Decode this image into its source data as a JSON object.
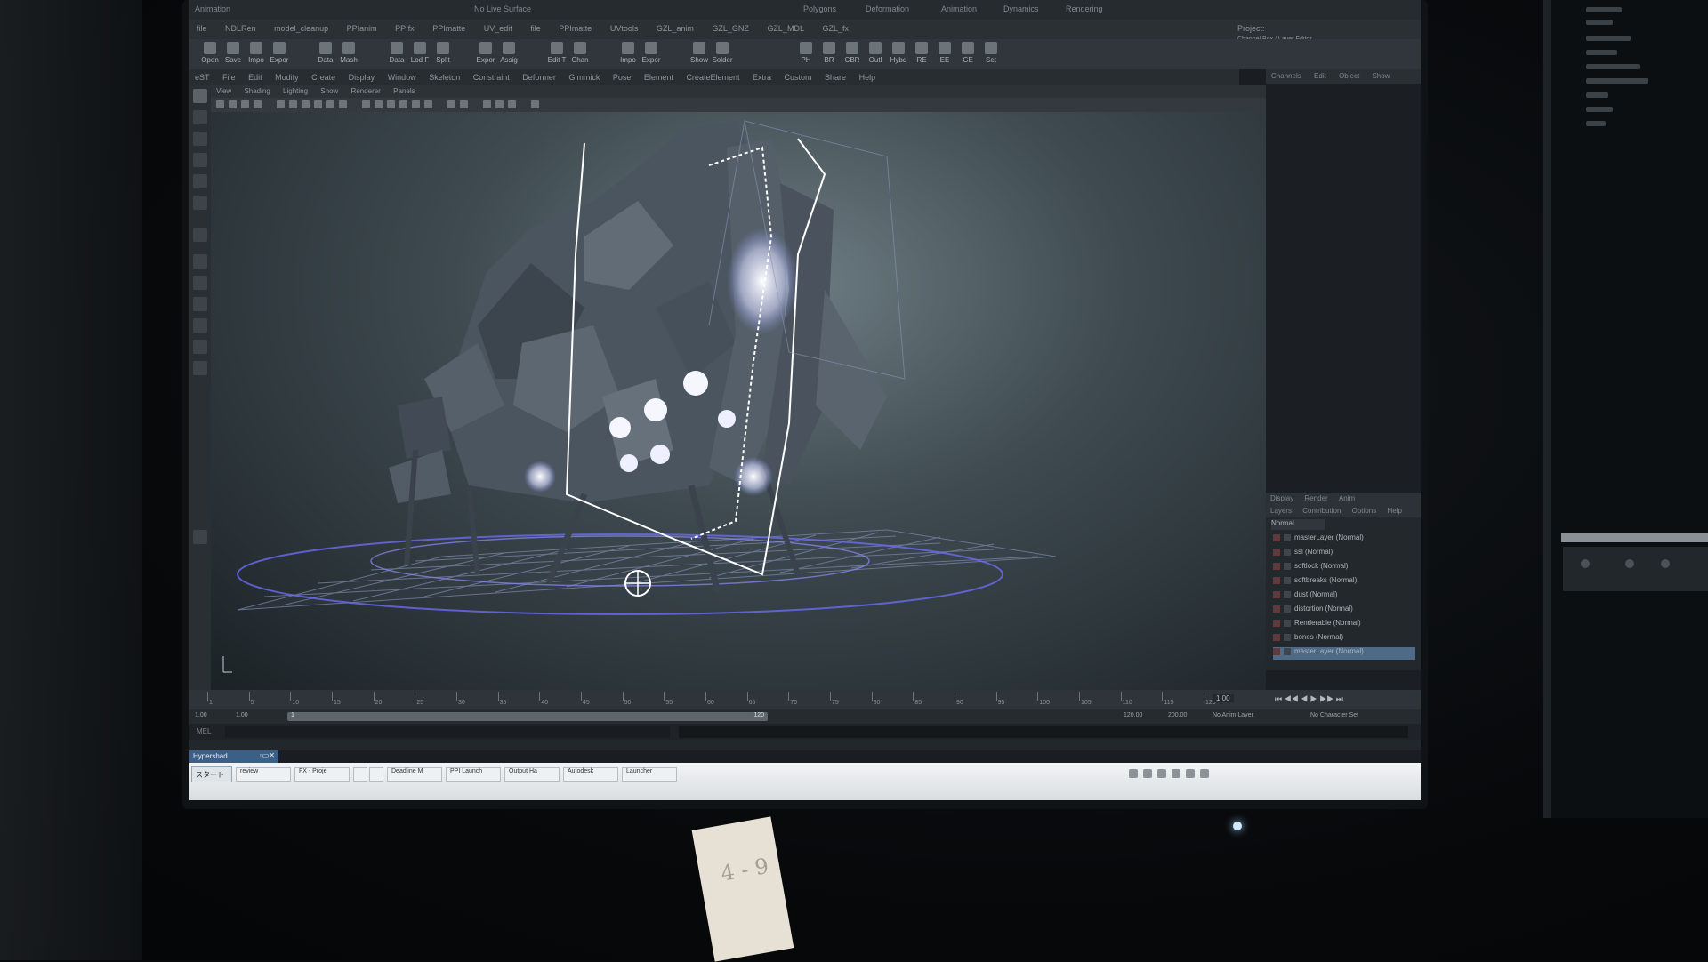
{
  "maya": {
    "mode": "Animation",
    "status_field": "No Live Surface",
    "top_menu": [
      "Polygons",
      "Deformation",
      "Animation",
      "Dynamics",
      "Rendering"
    ],
    "shelf_tabs": [
      "file",
      "NDLRen",
      "model_cleanup",
      "PPIanim",
      "PPIfx",
      "PPImatte",
      "UV_edit",
      "file",
      "PPImatte",
      "UVtools",
      "GZL_anim",
      "GZL_GNZ",
      "GZL_MDL",
      "GZL_fx"
    ],
    "shelf_buttons": [
      "Open",
      "Save",
      "Impo",
      "Expor",
      "Data",
      "Mash",
      "Data",
      "Lod F",
      "Split",
      "Expor",
      "Assig",
      "Edit T",
      "Chan",
      "Impo",
      "Expor",
      "Show",
      "Solder"
    ],
    "shelf_right_buttons": [
      "PH",
      "BR",
      "CBR",
      "Outl",
      "Hybd",
      "RE",
      "EE",
      "GE",
      "Set"
    ],
    "main_menu": [
      "eST",
      "File",
      "Edit",
      "Modify",
      "Create",
      "Display",
      "Window",
      "Skeleton",
      "Constraint",
      "Deformer",
      "Gimmick",
      "Pose",
      "Element",
      "CreateElement",
      "Extra",
      "Custom",
      "Share",
      "Help"
    ],
    "panel_menu": [
      "View",
      "Shading",
      "Lighting",
      "Show",
      "Renderer",
      "Panels"
    ],
    "channel_tabs": [
      "Channels",
      "Edit",
      "Object",
      "Show"
    ],
    "project_label": "Project:",
    "project_sub": "Channel Box / Layer Editor",
    "layer_tabs": [
      "Display",
      "Render",
      "Anim"
    ],
    "layer_subtabs": [
      "Layers",
      "Contribution",
      "Options",
      "Help"
    ],
    "layer_mode": "Normal",
    "layers": [
      "masterLayer (Normal)",
      "ssl (Normal)",
      "softlock (Normal)",
      "softbreaks (Normal)",
      "dust (Normal)",
      "distortion (Normal)",
      "Renderable (Normal)",
      "bones (Normal)",
      "masterLayer (Normal)"
    ],
    "timeline_ticks": [
      "1",
      "5",
      "10",
      "15",
      "20",
      "25",
      "30",
      "35",
      "40",
      "45",
      "50",
      "55",
      "60",
      "65",
      "70",
      "75",
      "80",
      "85",
      "90",
      "95",
      "100",
      "105",
      "110",
      "115",
      "120"
    ],
    "current_frame": "1.00",
    "range_start": "1.00",
    "range_inner_start": "1.00",
    "range_inner_value": "1",
    "range_inner_end": "120",
    "range_end": "120.00",
    "range_max": "200.00",
    "anim_layer": "No Anim Layer",
    "char_set": "No Character Set",
    "cmd_label": "MEL",
    "hypershade_tab": "Hypershad"
  },
  "taskbar": {
    "start_label": "スタート",
    "tasks": [
      "review",
      "FX - Proje",
      "",
      "",
      "Deadline M",
      "PPI Launch",
      "Output Ha",
      "Autodesk",
      "Launcher"
    ]
  },
  "note_text": "4 - 9"
}
